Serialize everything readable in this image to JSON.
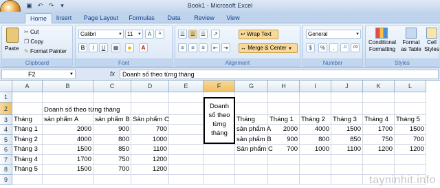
{
  "window": {
    "title": "Book1 - Microsoft Excel"
  },
  "tabs": [
    "Home",
    "Insert",
    "Page Layout",
    "Formulas",
    "Data",
    "Review",
    "View"
  ],
  "ribbon": {
    "clipboard": {
      "paste": "Paste",
      "cut": "Cut",
      "copy": "Copy",
      "format_painter": "Format Painter",
      "label": "Clipboard"
    },
    "font": {
      "name": "Calibri",
      "size": "11",
      "label": "Font"
    },
    "alignment": {
      "wrap_text": "Wrap Text",
      "merge_center": "Merge & Center",
      "label": "Alignment"
    },
    "number": {
      "format": "General",
      "label": "Number"
    },
    "styles": {
      "conditional": "Conditional",
      "formatting": "Formatting",
      "format": "Format",
      "as_table": "as Table",
      "cell": "Cell",
      "styles": "Styles",
      "label": "Styles"
    }
  },
  "formula_bar": {
    "name_box": "F2",
    "fx": "fx",
    "content": "Doanh số theo từng tháng"
  },
  "grid": {
    "columns": [
      "A",
      "B",
      "C",
      "D",
      "E",
      "F",
      "G",
      "H",
      "I",
      "J",
      "K",
      "L"
    ],
    "rows": [
      "1",
      "2",
      "3",
      "4",
      "5",
      "6",
      "7",
      "8",
      "9"
    ],
    "cells": {
      "B2": "Doanh số theo từng tháng",
      "A3": "Tháng",
      "B3": "sản phẩm A",
      "C3": "sản phẩm B",
      "D3": "Sản phẩm C",
      "A4": "Tháng 1",
      "B4": "2000",
      "C4": "900",
      "D4": "700",
      "A5": "Tháng 2",
      "B5": "4000",
      "C5": "800",
      "D5": "1000",
      "A6": "Tháng 3",
      "B6": "1500",
      "C6": "850",
      "D6": "1100",
      "A7": "Tháng 4",
      "B7": "1700",
      "C7": "750",
      "D7": "1200",
      "A8": "Tháng 5",
      "B8": "1500",
      "C8": "700",
      "D8": "1200",
      "F2": "Doanh số theo từng tháng",
      "G3": "Tháng",
      "H3": "Tháng 1",
      "I3": "Tháng 2",
      "J3": "Tháng 3",
      "K3": "Tháng 4",
      "L3": "Tháng 5",
      "G4": "sản phẩm A",
      "H4": "2000",
      "I4": "4000",
      "J4": "1500",
      "K4": "1700",
      "L4": "1500",
      "G5": "sản phẩm B",
      "H5": "900",
      "I5": "800",
      "J5": "850",
      "K5": "750",
      "L5": "700",
      "G6": "Sản phẩm C",
      "H6": "700",
      "I6": "1000",
      "J6": "1100",
      "K6": "1200",
      "L6": "1200"
    }
  },
  "watermark": "tayninhit.info"
}
